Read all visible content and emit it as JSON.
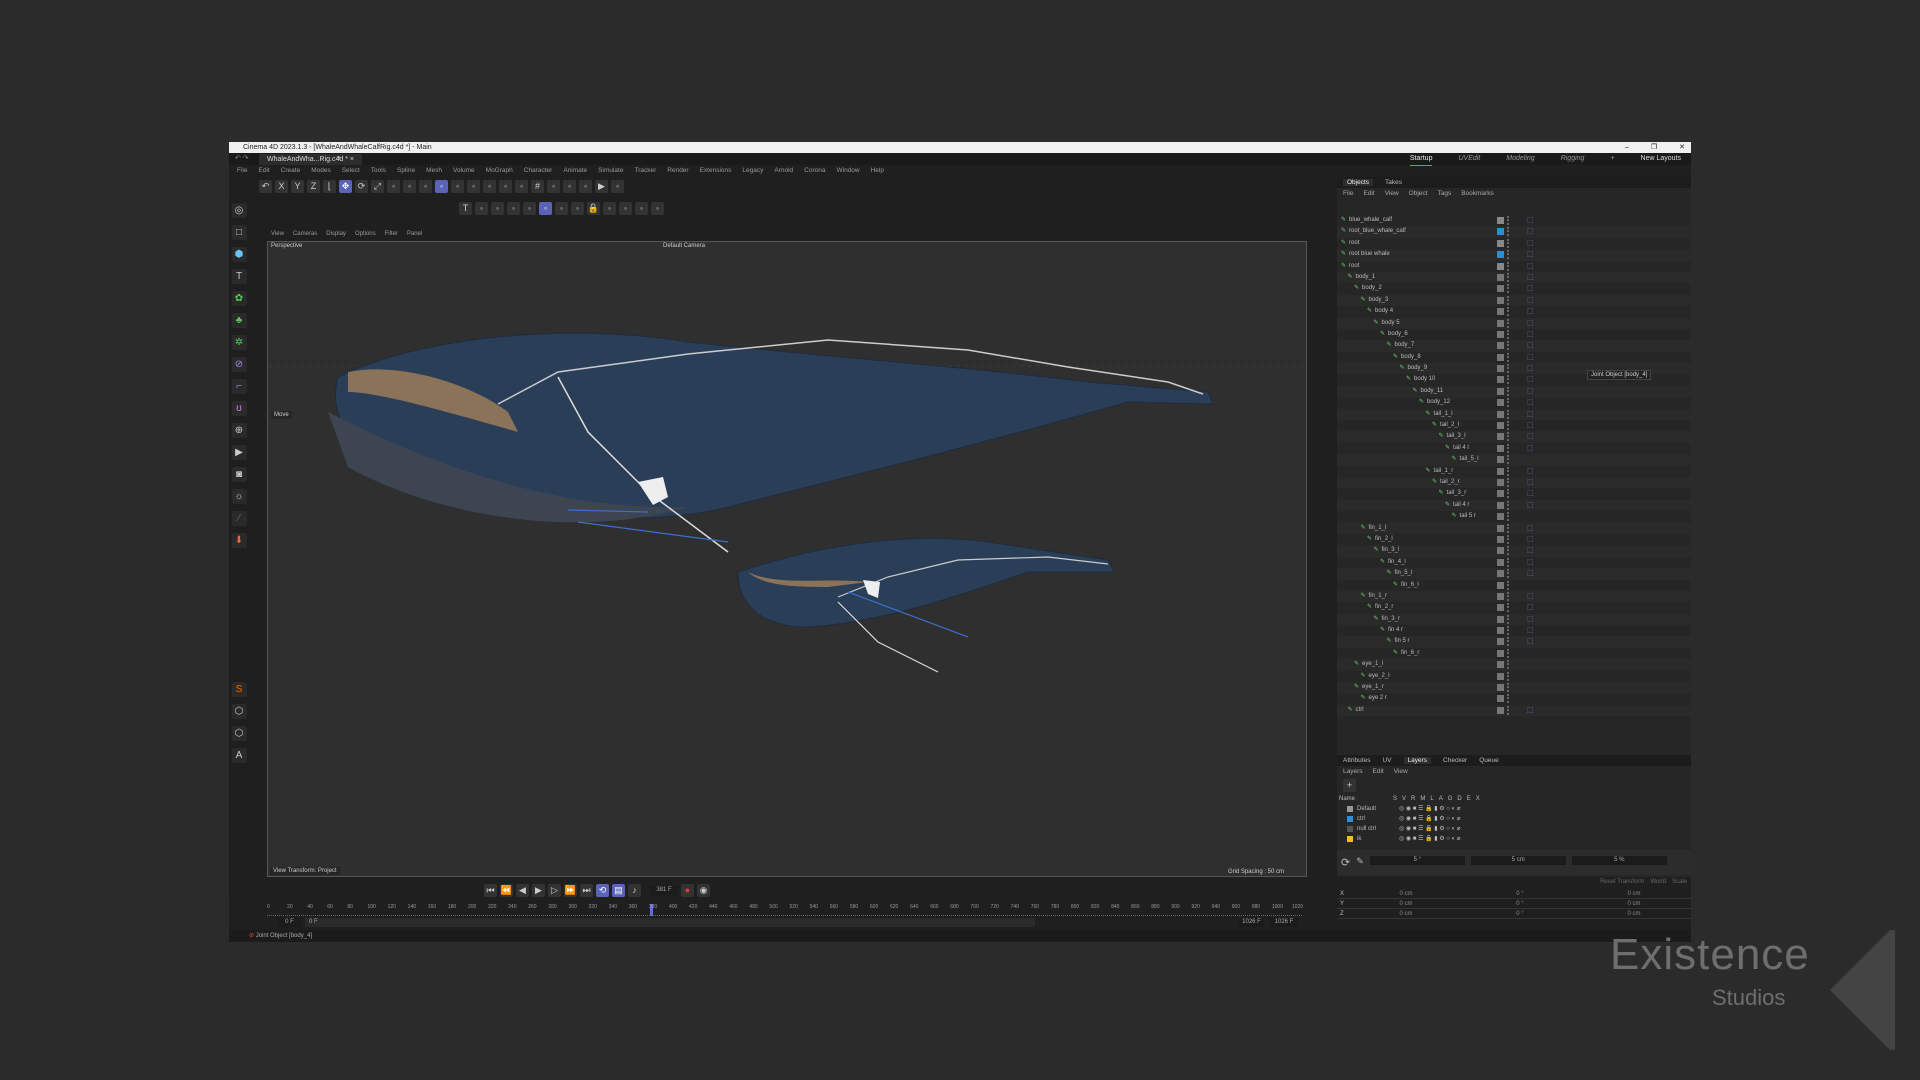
{
  "window": {
    "title": "Cinema 4D 2023.1.3 - [WhaleAndWhaleCalfRig.c4d *] - Main",
    "controls": [
      "–",
      "❐",
      "✕"
    ]
  },
  "doc_tab": {
    "label": "WhaleAndWha...Rig.c4d *",
    "close": "×",
    "add": "+"
  },
  "layouts": {
    "items": [
      "Startup",
      "UVEdit",
      "Modeling",
      "Rigging"
    ],
    "add": "+",
    "new_layouts": "New Layouts"
  },
  "menu": [
    "File",
    "Edit",
    "Create",
    "Modes",
    "Select",
    "Tools",
    "Spline",
    "Mesh",
    "Volume",
    "MoGraph",
    "Character",
    "Animate",
    "Simulate",
    "Tracker",
    "Render",
    "Extensions",
    "Legacy",
    "Arnold",
    "Corona",
    "Window",
    "Help"
  ],
  "toolbar1": [
    "undo-icon",
    "x-axis-icon",
    "y-axis-icon",
    "z-axis-icon",
    "coord-system-icon",
    "move-icon",
    "rotate-icon",
    "scale-icon",
    "points-mode-icon",
    "edges-mode-icon",
    "polygons-mode-icon",
    "model-mode-icon",
    "texture-mode-icon",
    "axis-icon",
    "solo-icon",
    "snap-icon",
    "snap-settings-icon",
    "grid-icon",
    "workplane-icon",
    "symmetry-icon",
    "render-view-icon",
    "render-icon",
    "render-settings-icon"
  ],
  "toolbar2": [
    "text-icon",
    "text-spline-icon",
    "text-object-icon",
    "plugin-a-icon",
    "plugin-b-icon",
    "viewport-shading-icon",
    "lighting-icon",
    "backface-icon",
    "lock-icon",
    "pin-icon",
    "measure-icon",
    "magnet-icon",
    "paint-icon"
  ],
  "viewport": {
    "menu": [
      "View",
      "Cameras",
      "Display",
      "Options",
      "Filter",
      "Panel"
    ],
    "projection": "Perspective",
    "camera": "Default Camera",
    "hud_tool": "Move",
    "view_transform": "View Transform: Project",
    "grid_spacing": "Grid Spacing : 50 cm"
  },
  "objects": {
    "tabs": [
      "Objects",
      "Takes"
    ],
    "menu": [
      "File",
      "Edit",
      "View",
      "Object",
      "Tags",
      "Bookmarks"
    ],
    "rows": [
      {
        "name": "blue_whale_calf",
        "depth": 0,
        "color": "#888888"
      },
      {
        "name": "root_blue_whale_calf",
        "depth": 0,
        "color": "#2a8fd6"
      },
      {
        "name": "root",
        "depth": 0,
        "color": "#888888"
      },
      {
        "name": "root blue whale",
        "depth": 0,
        "color": "#2a8fd6"
      },
      {
        "name": "root",
        "depth": 0,
        "color": "#888888"
      },
      {
        "name": "body_1",
        "depth": 1
      },
      {
        "name": "body_2",
        "depth": 2
      },
      {
        "name": "body_3",
        "depth": 3
      },
      {
        "name": "body 4",
        "depth": 4
      },
      {
        "name": "body 5",
        "depth": 5
      },
      {
        "name": "body_6",
        "depth": 6
      },
      {
        "name": "body_7",
        "depth": 7
      },
      {
        "name": "body_8",
        "depth": 8
      },
      {
        "name": "body_9",
        "depth": 9
      },
      {
        "name": "body 10",
        "depth": 10
      },
      {
        "name": "body_11",
        "depth": 11
      },
      {
        "name": "body_12",
        "depth": 12
      },
      {
        "name": "tail_1_l",
        "depth": 13
      },
      {
        "name": "tail_2_l",
        "depth": 14
      },
      {
        "name": "tail_3_l",
        "depth": 15
      },
      {
        "name": "tail 4 l",
        "depth": 16
      },
      {
        "name": "tail_5_l",
        "depth": 17
      },
      {
        "name": "tail_1_r",
        "depth": 13
      },
      {
        "name": "tail_2_r",
        "depth": 14
      },
      {
        "name": "tail_3_r",
        "depth": 15
      },
      {
        "name": "tail 4 r",
        "depth": 16
      },
      {
        "name": "tail 5 r",
        "depth": 17
      },
      {
        "name": "fin_1_l",
        "depth": 3
      },
      {
        "name": "fin_2_l",
        "depth": 4
      },
      {
        "name": "fin_3_l",
        "depth": 5
      },
      {
        "name": "fin_4_l",
        "depth": 6
      },
      {
        "name": "fin_5_l",
        "depth": 7
      },
      {
        "name": "fin_6_l",
        "depth": 8
      },
      {
        "name": "fin_1_r",
        "depth": 3
      },
      {
        "name": "fin_2_r",
        "depth": 4
      },
      {
        "name": "fin_3_r",
        "depth": 5
      },
      {
        "name": "fin 4 r",
        "depth": 6
      },
      {
        "name": "fin 5 r",
        "depth": 7
      },
      {
        "name": "fin_6_r",
        "depth": 8
      },
      {
        "name": "eye_1_l",
        "depth": 2
      },
      {
        "name": "eye_2_l",
        "depth": 3
      },
      {
        "name": "eye_1_r",
        "depth": 2
      },
      {
        "name": "eye 2 r",
        "depth": 3
      },
      {
        "name": "ctrl",
        "depth": 1
      }
    ],
    "tooltip": "Joint Object [body_4]"
  },
  "bottom": {
    "tabs": [
      "Attributes",
      "UV",
      "Layers",
      "Checker",
      "Queue"
    ],
    "menu": [
      "Layers",
      "Edit",
      "View"
    ],
    "layer_header": {
      "name": "Name",
      "cols": [
        "S",
        "V",
        "R",
        "M",
        "L",
        "A",
        "G",
        "D",
        "E",
        "X"
      ]
    },
    "layers": [
      {
        "name": "Default",
        "color": "#999999"
      },
      {
        "name": "ctrl",
        "color": "#2a8fd6"
      },
      {
        "name": "null ctrl",
        "color": "#555555"
      },
      {
        "name": "ik",
        "color": "#f0c020"
      }
    ],
    "snap_fields": [
      "5 °",
      "5 cm",
      "5 %"
    ],
    "coord_buttons": [
      "Reset Transform",
      "World",
      "Scale"
    ],
    "coords": [
      [
        "X",
        "0 cm",
        "0 °",
        "0 cm"
      ],
      [
        "Y",
        "0 cm",
        "0 °",
        "0 cm"
      ],
      [
        "Z",
        "0 cm",
        "0 °",
        "0 cm"
      ]
    ]
  },
  "timeline": {
    "current_frame": "381 F",
    "start": "0 F",
    "start2": "0 F",
    "end": "1026 F",
    "end2": "1026 F",
    "range_max": 1026,
    "current": 381
  },
  "status": {
    "text": "Joint Object [body_4]"
  },
  "watermark": {
    "line1": "Existence",
    "line2": "Studios"
  }
}
